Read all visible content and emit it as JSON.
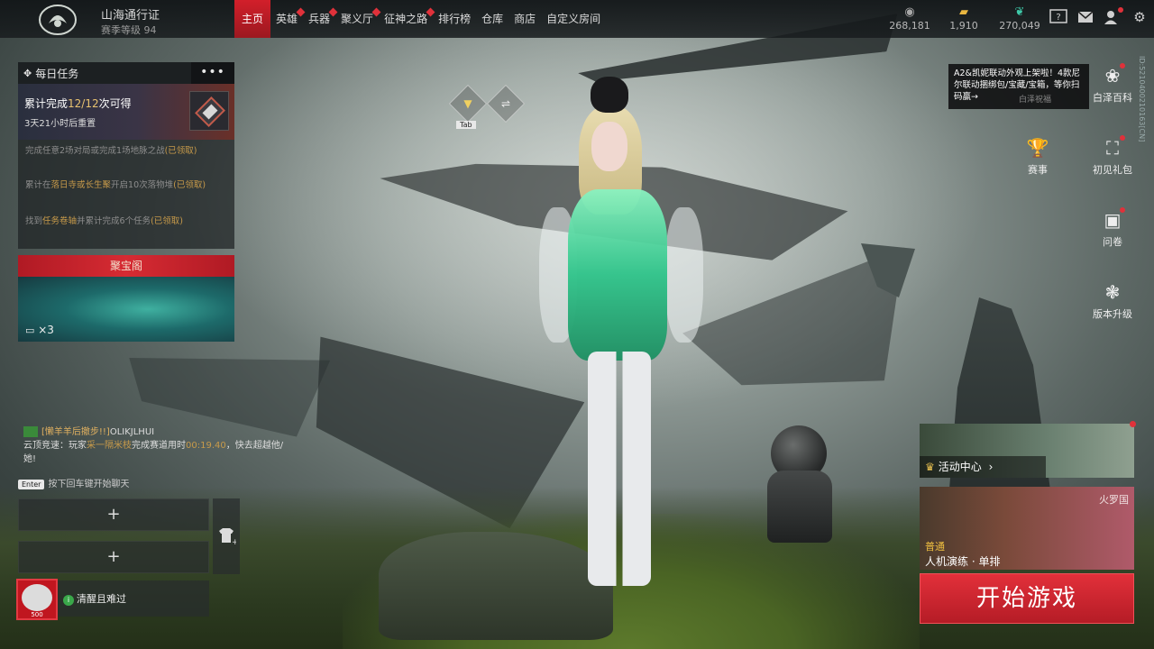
{
  "topbar": {
    "pass_title": "山海通行证",
    "pass_level": "赛季等级 94",
    "nav": [
      {
        "label": "主页",
        "active": true,
        "badge": false
      },
      {
        "label": "英雄",
        "active": false,
        "badge": true
      },
      {
        "label": "兵器",
        "active": false,
        "badge": true
      },
      {
        "label": "聚义厅",
        "active": false,
        "badge": true
      },
      {
        "label": "征神之路",
        "active": false,
        "badge": true
      },
      {
        "label": "排行榜",
        "active": false,
        "badge": false
      },
      {
        "label": "仓库",
        "active": false,
        "badge": false
      },
      {
        "label": "商店",
        "active": false,
        "badge": false
      },
      {
        "label": "自定义房间",
        "active": false,
        "badge": false
      }
    ],
    "currencies": [
      {
        "icon": "coin-icon",
        "value": "268,181"
      },
      {
        "icon": "gold-bar-icon",
        "value": "1,910"
      },
      {
        "icon": "jade-icon",
        "value": "270,049"
      }
    ],
    "icons": [
      "help-icon",
      "mail-icon",
      "friends-icon",
      "settings-icon"
    ]
  },
  "daily": {
    "title": "每日任务",
    "more": "•••",
    "banner_prefix": "累计完成",
    "banner_count": "12/12",
    "banner_suffix": "次可得",
    "reset": "3天21小时后重置",
    "tasks": [
      {
        "pre": "完成任意2场对局或完成1场地脉之战",
        "hl": "(已领取)",
        "post": ""
      },
      {
        "pre": "累计在",
        "hl": "落日寺或长生聚",
        "post": "开启10次落物堆",
        "hl2": "(已领取)"
      },
      {
        "pre": "找到",
        "hl": "任务卷轴",
        "post": "并累计完成6个任务",
        "hl2": "(已领取)"
      }
    ]
  },
  "treasure": {
    "title": "聚宝阁",
    "count": "×3"
  },
  "chat": {
    "team": "[懒羊羊后撤步!!]",
    "name": "OLIKJLHUI",
    "line_pre": "云顶竞速：玩家",
    "player": "采一隔米枝",
    "line_mid": "完成赛道用时",
    "time": "00:19.40",
    "line_post": "，快去超越他/她!",
    "enter_key": "Enter",
    "enter_hint": "按下回车键开始聊天"
  },
  "slots": {
    "add": "+"
  },
  "player": {
    "level": "500",
    "status_icon": "i",
    "status": "清醒且难过"
  },
  "center": {
    "tab_label": "Tab"
  },
  "right": {
    "promo": "A2&凯妮联动外观上架啦！4款尼尔联动捆绑包/宝藏/宝箱，等你扫码赢→",
    "promo_sub": "白泽祝福",
    "id_str": "ID:5210400210163[CN]",
    "buttons": [
      {
        "icon": "baize-icon",
        "label": "白泽百科",
        "badge": true
      },
      {
        "icon": "trophy-icon",
        "label": "赛事",
        "badge": false
      },
      {
        "icon": "gift-icon",
        "label": "初见礼包",
        "badge": true
      },
      {
        "icon": "survey-icon",
        "label": "问卷",
        "badge": true
      },
      {
        "icon": "update-icon",
        "label": "版本升级",
        "badge": false
      }
    ],
    "activity": "活动中心",
    "mode_map": "火罗国",
    "mode_difficulty": "普通",
    "mode_name": "人机演练 · 单排",
    "start": "开始游戏"
  }
}
